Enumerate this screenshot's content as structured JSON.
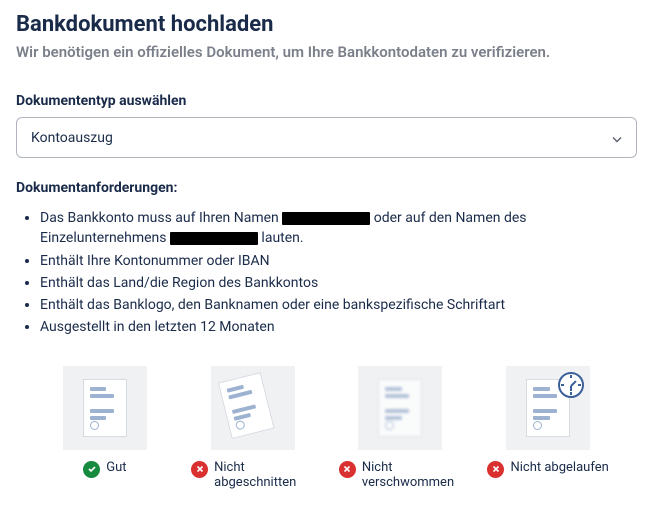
{
  "title": "Bankdokument hochladen",
  "subtitle": "Wir benötigen ein offizielles Dokument, um Ihre Bankkontodaten zu verifizieren.",
  "doctype_label": "Dokumententyp auswählen",
  "doctype_selected": "Kontoauszug",
  "requirements_head": "Dokumentanforderungen:",
  "requirements": {
    "r1_pre": "Das Bankkonto muss auf Ihren Namen ",
    "r1_mid": " oder auf den Namen des Einzelunternehmens ",
    "r1_post": " lauten.",
    "r2": "Enthält Ihre Kontonummer oder IBAN",
    "r3": "Enthält das Land/die Region des Bankkontos",
    "r4": "Enthält das Banklogo, den Banknamen oder eine bankspezifische Schriftart",
    "r5": "Ausgestellt in den letzten 12 Monaten"
  },
  "examples": {
    "good": "Gut",
    "not_cropped": "Nicht abgeschnitten",
    "not_blurry": "Nicht verschwommen",
    "not_expired": "Nicht abgelaufen"
  }
}
